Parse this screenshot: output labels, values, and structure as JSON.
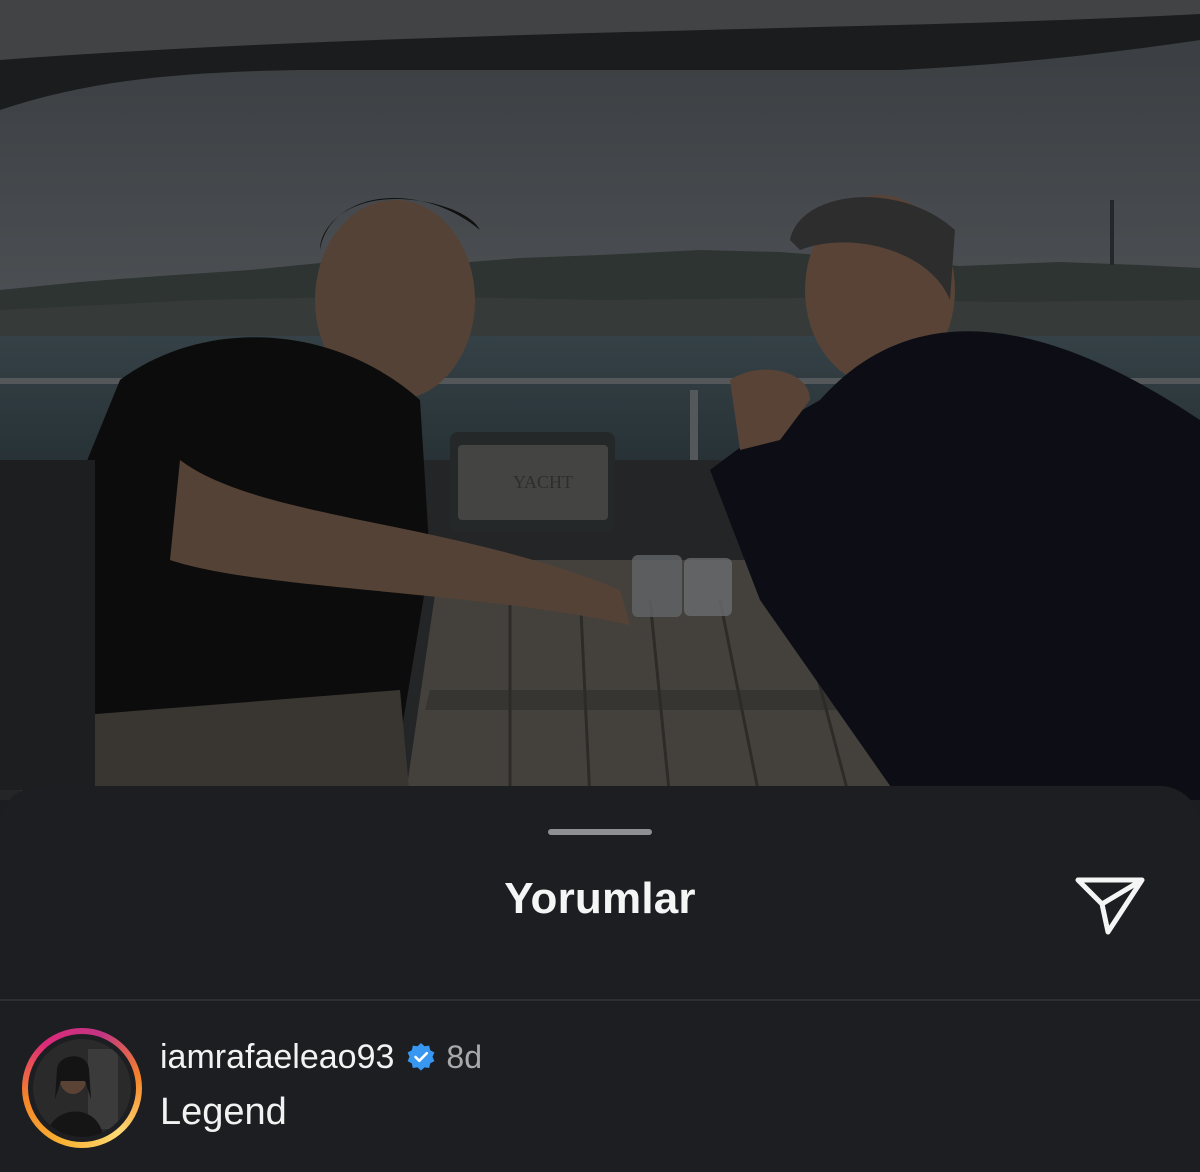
{
  "post": {
    "image_alt": "two men talking at a table on a yacht",
    "seat_label": "YACHT"
  },
  "comments_sheet": {
    "title": "Yorumlar"
  },
  "comments": [
    {
      "username": "iamrafaeleao93",
      "verified": true,
      "time": "8d",
      "text": "Legend"
    }
  ],
  "colors": {
    "sheet_bg": "#1c1e21",
    "verified_blue": "#3897f0",
    "text_primary": "#f2f2f2",
    "text_secondary": "#a8a9ab"
  },
  "icons": {
    "share": "paper-plane-icon",
    "verified": "verified-badge-icon"
  }
}
